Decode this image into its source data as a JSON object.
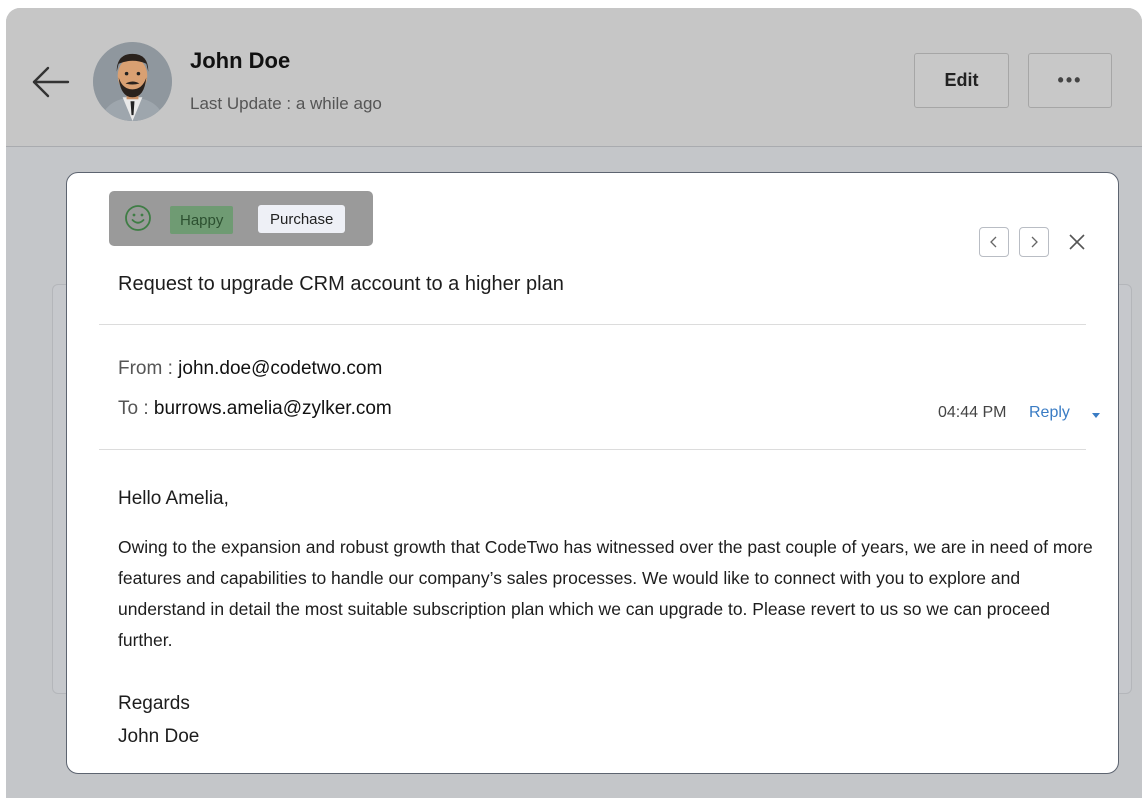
{
  "header": {
    "contact_name": "John Doe",
    "last_update": "Last Update : a while ago",
    "edit_label": "Edit",
    "more_label": "•••"
  },
  "email": {
    "tags": {
      "sentiment": "Happy",
      "category": "Purchase"
    },
    "subject": "Request to upgrade CRM account to a higher plan",
    "from_label": "From : ",
    "from_value": "john.doe@codetwo.com",
    "to_label": "To :  ",
    "to_value": "burrows.amelia@zylker.com",
    "time": "04:44 PM",
    "reply_label": "Reply",
    "greeting": "Hello Amelia,",
    "body": "Owing to the expansion and robust growth that CodeTwo has witnessed over the past couple of years, we are in need of more features and capabilities to handle our company’s sales processes. We would like to connect with you to explore and understand in detail the most suitable subscription plan which we can upgrade to. Please revert to us so we can proceed further.",
    "closing": "Regards",
    "signature": "John Doe"
  },
  "icons": {
    "back": "back-arrow-icon",
    "sentiment": "smiley-icon",
    "prev": "chevron-left-icon",
    "next": "chevron-right-icon",
    "close": "close-icon",
    "reply_menu": "caret-down-icon"
  },
  "colors": {
    "reply_link": "#3a7cc4",
    "happy_tag_bg": "#6f9b73",
    "happy_tag_text": "#2c5030",
    "smiley": "#3f7d45"
  }
}
